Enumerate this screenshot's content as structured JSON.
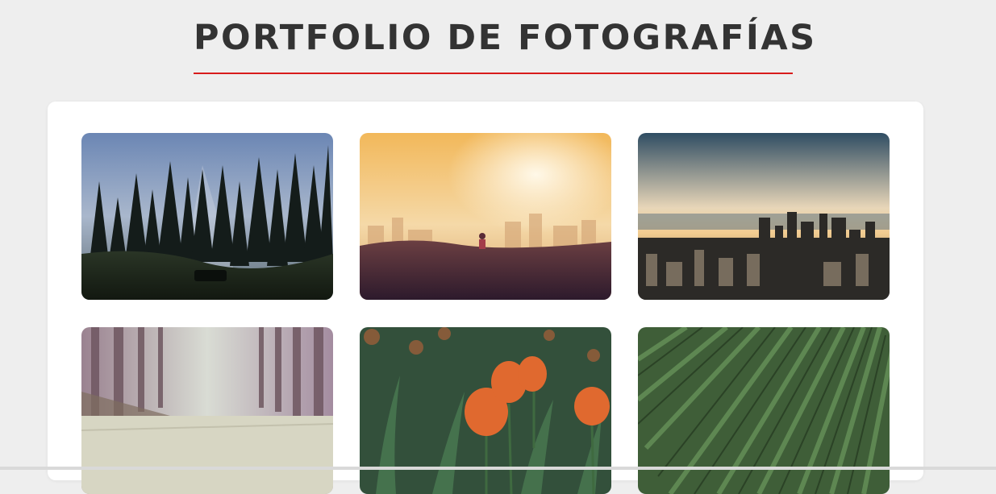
{
  "header": {
    "title": "PORTFOLIO DE FOTOGRAFÍAS",
    "underline_color": "#d81b1b"
  },
  "gallery": {
    "photos": [
      {
        "subject": "forest-silhouette-photo"
      },
      {
        "subject": "sunset-runner-photo"
      },
      {
        "subject": "city-skyline-photo"
      },
      {
        "subject": "misty-tree-road-photo"
      },
      {
        "subject": "orange-tulips-photo"
      },
      {
        "subject": "green-tea-field-photo"
      }
    ]
  },
  "colors": {
    "background": "#eeeeee",
    "card": "#ffffff",
    "title": "#333333",
    "accent": "#d81b1b"
  }
}
